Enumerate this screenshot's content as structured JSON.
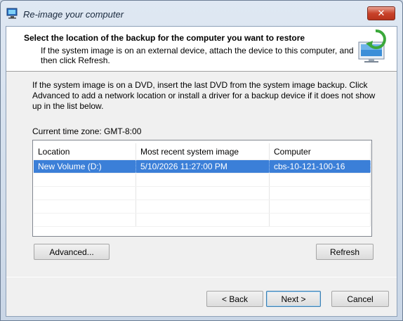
{
  "window": {
    "title": "Re-image your computer",
    "close_glyph": "✕"
  },
  "header": {
    "title": "Select the location of the backup for the computer you want to restore",
    "subtitle": "If the system image is on an external device, attach the device to this computer, and then click Refresh.",
    "icon": "computer-restore-icon"
  },
  "instructions": "If the system image is on a DVD, insert the last DVD from the system image backup. Click Advanced to add a network location or install a driver for a backup device if it does not show up in the list below.",
  "timezone": "Current time zone: GMT-8:00",
  "table": {
    "columns": [
      "Location",
      "Most recent system image",
      "Computer"
    ],
    "rows": [
      {
        "location": "New Volume (D:)",
        "image": "5/10/2026 11:27:00 PM",
        "computer": "cbs-10-121-100-16",
        "selected": true
      }
    ]
  },
  "buttons": {
    "advanced": "Advanced...",
    "refresh": "Refresh",
    "back": "< Back",
    "next": "Next >",
    "cancel": "Cancel"
  },
  "colors": {
    "selection": "#3b7fd8",
    "close": "#c8432a"
  }
}
